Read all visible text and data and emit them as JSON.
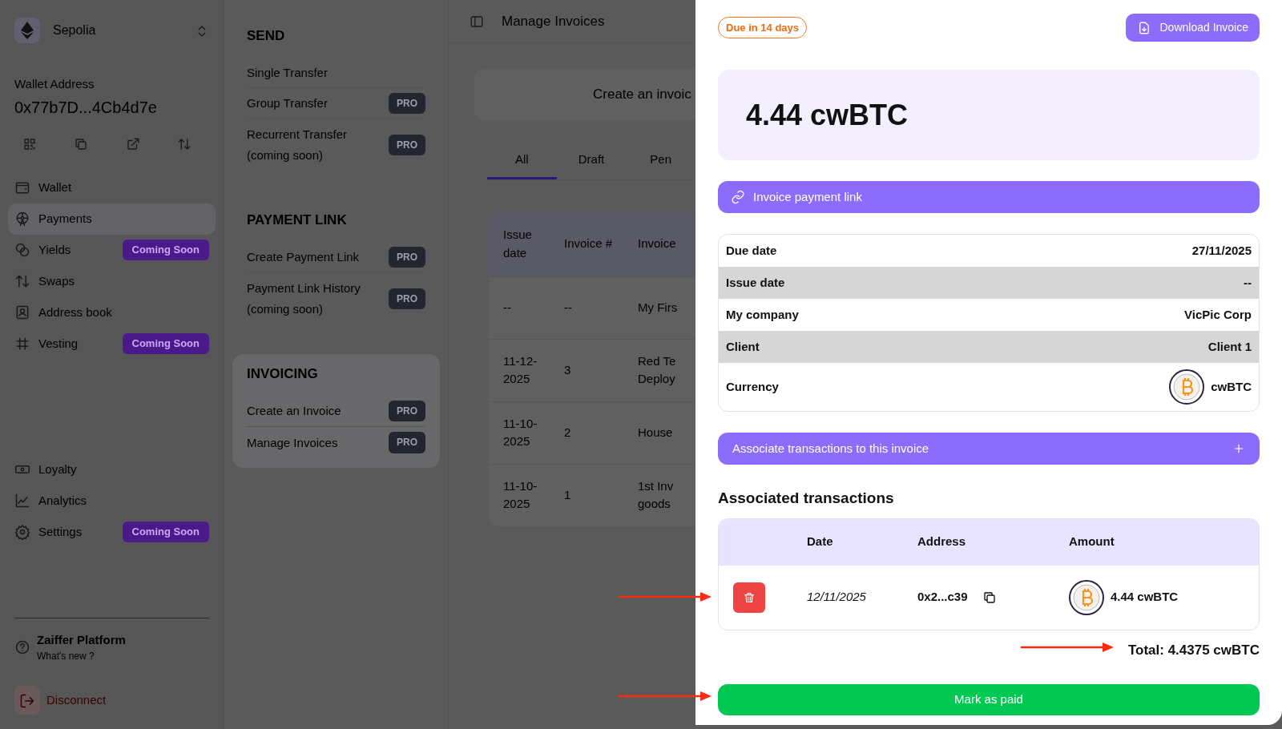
{
  "sidebar": {
    "network": "Sepolia",
    "wallet_label": "Wallet Address",
    "wallet_address": "0x77b7D...4Cb4d7e",
    "nav_top": [
      {
        "label": "Wallet",
        "selected": false
      },
      {
        "label": "Payments",
        "selected": true
      },
      {
        "label": "Yields",
        "selected": false,
        "badge": "Coming Soon"
      },
      {
        "label": "Swaps",
        "selected": false
      },
      {
        "label": "Address book",
        "selected": false
      },
      {
        "label": "Vesting",
        "selected": false,
        "badge": "Coming Soon"
      }
    ],
    "nav_bottom": [
      {
        "label": "Loyalty",
        "selected": false
      },
      {
        "label": "Analytics",
        "selected": false
      },
      {
        "label": "Settings",
        "selected": false,
        "badge": "Coming Soon"
      }
    ],
    "footer": {
      "title": "Zaiffer Platform",
      "subtitle": "What's new ?"
    },
    "disconnect": "Disconnect"
  },
  "submenu": {
    "sections": [
      {
        "title": "SEND",
        "selected": false,
        "items": [
          {
            "label": "Single Transfer"
          },
          {
            "label": "Group Transfer",
            "badge": "PRO"
          },
          {
            "label": "Recurrent Transfer (coming soon)",
            "badge": "PRO"
          }
        ]
      },
      {
        "title": "PAYMENT LINK",
        "selected": false,
        "items": [
          {
            "label": "Create Payment Link",
            "badge": "PRO"
          },
          {
            "label": "Payment Link History (coming soon)",
            "badge": "PRO"
          }
        ]
      },
      {
        "title": "INVOICING",
        "selected": true,
        "items": [
          {
            "label": "Create an Invoice",
            "badge": "PRO"
          },
          {
            "label": "Manage Invoices",
            "badge": "PRO"
          }
        ]
      }
    ]
  },
  "main": {
    "title": "Manage Invoices",
    "create_banner": "Create an invoic",
    "tabs": [
      {
        "label": "All",
        "selected": true
      },
      {
        "label": "Draft",
        "selected": false
      },
      {
        "label": "Pen",
        "selected": false
      }
    ],
    "table": {
      "columns": [
        "Issue date",
        "Invoice #",
        "Invoice"
      ],
      "rows": [
        {
          "issue_date": "--",
          "number": "--",
          "title_lines": [
            "My Firs"
          ]
        },
        {
          "issue_date": "11-12-2025",
          "number": "3",
          "title_lines": [
            "Red Te",
            "Deploy"
          ]
        },
        {
          "issue_date": "11-10-2025",
          "number": "2",
          "title_lines": [
            "House"
          ]
        },
        {
          "issue_date": "11-10-2025",
          "number": "1",
          "title_lines": [
            "1st Inv",
            "goods"
          ]
        }
      ]
    }
  },
  "drawer": {
    "due_badge": "Due in 14 days",
    "download_button": "Download Invoice",
    "amount": "4.44 cwBTC",
    "payment_link": "Invoice payment link",
    "details": [
      {
        "label": "Due date",
        "value": "27/11/2025",
        "kind": "text"
      },
      {
        "label": "Issue date",
        "value": "--",
        "kind": "text"
      },
      {
        "label": "My company",
        "value": "VicPic Corp",
        "kind": "text"
      },
      {
        "label": "Client",
        "value": "Client 1",
        "kind": "text"
      },
      {
        "label": "Currency",
        "value": "cwBTC",
        "kind": "token"
      }
    ],
    "associate_button": "Associate transactions to this invoice",
    "transactions_title": "Associated transactions",
    "transactions": {
      "columns": [
        "Date",
        "Address",
        "Amount"
      ],
      "rows": [
        {
          "date": "12/11/2025",
          "address": "0x2...c39",
          "amount": "4.44 cwBTC"
        }
      ]
    },
    "total": "Total: 4.4375 cwBTC",
    "mark_paid_button": "Mark as paid"
  }
}
